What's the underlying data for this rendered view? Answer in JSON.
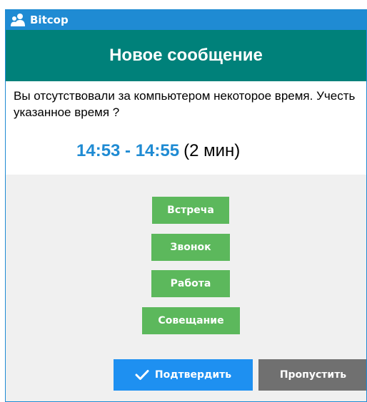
{
  "window": {
    "app_title": "Bitcop",
    "app_icon": "users-icon"
  },
  "dialog": {
    "heading": "Новое сообщение",
    "message": "Вы отсутствовали за компьютером некоторое время. Учесть указанное время ?",
    "time_range": "14:53 - 14:55",
    "duration": "(2 мин)"
  },
  "categories": [
    "Встреча",
    "Звонок",
    "Работа",
    "Совещание"
  ],
  "actions": {
    "confirm_label": "Подтвердить",
    "confirm_icon": "check-icon",
    "skip_label": "Пропустить"
  },
  "colors": {
    "titlebar": "#1f8bd3",
    "header": "#00817a",
    "time_accent": "#1f8bd3",
    "category_button": "#5cb85c",
    "confirm_button": "#1e90f1",
    "skip_button": "#707070"
  }
}
